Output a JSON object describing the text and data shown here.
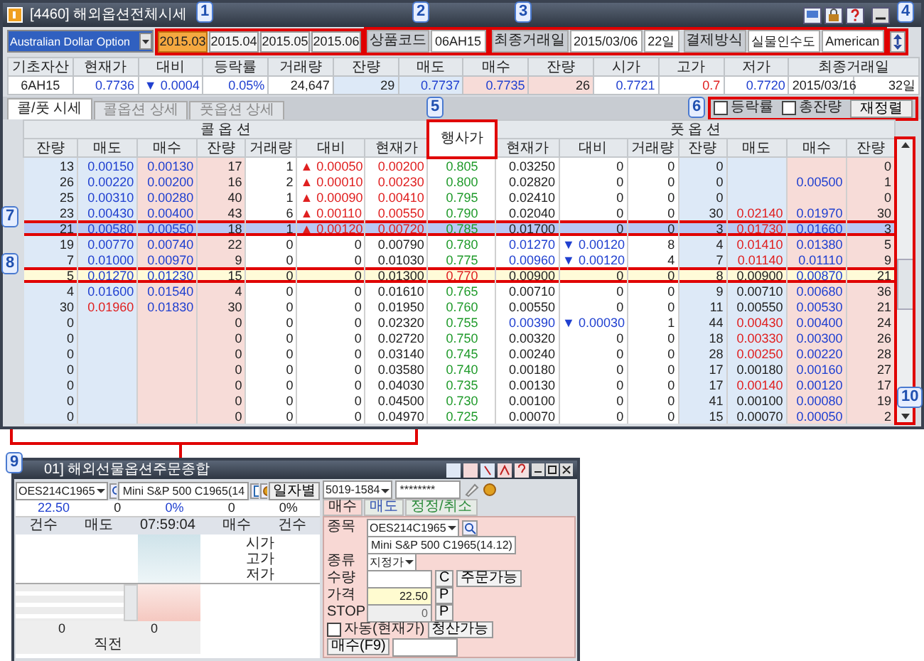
{
  "window": {
    "title": "[4460] 해외옵션전체시세"
  },
  "product_select": {
    "value": "Australian Dollar Option"
  },
  "months": [
    {
      "label": "2015.03",
      "selected": true
    },
    {
      "label": "2015.04",
      "selected": false
    },
    {
      "label": "2015.05",
      "selected": false
    },
    {
      "label": "2015.06",
      "selected": false
    }
  ],
  "product_code": {
    "label": "상품코드",
    "value": "06AH15"
  },
  "last_trade": {
    "label": "최종거래일",
    "date": "2015/03/06",
    "days": "22일"
  },
  "settlement": {
    "label": "결제방식",
    "method": "실물인수도",
    "style": "American"
  },
  "info": {
    "headers": [
      "기초자산",
      "현재가",
      "대비",
      "등락률",
      "거래량",
      "잔량",
      "매도",
      "매수",
      "잔량",
      "시가",
      "고가",
      "저가",
      "최종거래일"
    ],
    "cells": [
      {
        "text": "6AH15",
        "color": "#222222"
      },
      {
        "text": "0.7736",
        "color": "#2040d0"
      },
      {
        "text": "▼ 0.0004",
        "color": "#2040d0"
      },
      {
        "text": "0.05%",
        "color": "#2040d0"
      },
      {
        "text": "24,647",
        "color": "#222222"
      },
      {
        "text": "29",
        "color": "#222222"
      },
      {
        "text": "0.7737",
        "color": "#2040d0"
      },
      {
        "text": "0.7735",
        "color": "#2040d0"
      },
      {
        "text": "26",
        "color": "#222222"
      },
      {
        "text": "0.7721",
        "color": "#2040d0"
      },
      {
        "text": "0.7",
        "color": "#e02020"
      },
      {
        "text": "0.7720",
        "color": "#2040d0"
      },
      {
        "text": "2015/03/16",
        "color": "#222222"
      },
      {
        "text": "32일",
        "color": "#222222"
      }
    ]
  },
  "tabs": [
    {
      "label": "콜/풋 시세",
      "selected": true
    },
    {
      "label": "콜옵션 상세",
      "selected": false
    },
    {
      "label": "풋옵션 상세",
      "selected": false
    }
  ],
  "options": [
    {
      "label": "등락률",
      "checked": false
    },
    {
      "label": "총잔량",
      "checked": false
    }
  ],
  "rearrange_button": "재정렬",
  "table": {
    "call_title": "콜 옵 션",
    "put_title": "풋 옵 션",
    "strike_header": "행사가",
    "call_columns": [
      "잔량",
      "매도",
      "매수",
      "잔량",
      "거래량",
      "대비",
      "현재가"
    ],
    "put_columns": [
      "현재가",
      "대비",
      "거래량",
      "잔량",
      "매도",
      "매수",
      "잔량"
    ],
    "rows": [
      {
        "strike": "0.805",
        "call": {
          "ask_size": "13",
          "ask": {
            "text": "0.00150",
            "color": "#2040d0"
          },
          "bid": "0.00130",
          "bid_size": "17",
          "volume": "1",
          "change": {
            "text": "▲ 0.00050",
            "color": "#e02020"
          },
          "price": {
            "text": "0.00200",
            "color": "#e02020"
          }
        },
        "put": {
          "price": {
            "text": "0.03250",
            "color": "#222222"
          },
          "change": {
            "text": "0",
            "color": "#222222"
          },
          "volume": "0",
          "ask_size": "0",
          "bid_size": "0"
        },
        "selected": false,
        "at_the_money": false
      },
      {
        "strike": "0.800",
        "call": {
          "ask_size": "26",
          "ask": {
            "text": "0.00220",
            "color": "#2040d0"
          },
          "bid": "0.00200",
          "bid_size": "16",
          "volume": "2",
          "change": {
            "text": "▲ 0.00010",
            "color": "#e02020"
          },
          "price": {
            "text": "0.00230",
            "color": "#e02020"
          }
        },
        "put": {
          "price": {
            "text": "0.02820",
            "color": "#222222"
          },
          "change": {
            "text": "0",
            "color": "#222222"
          },
          "volume": "0",
          "ask_size": "0",
          "bid": "0.00500",
          "bid_size": "1"
        },
        "selected": false,
        "at_the_money": false
      },
      {
        "strike": "0.795",
        "call": {
          "ask_size": "25",
          "ask": {
            "text": "0.00310",
            "color": "#2040d0"
          },
          "bid": "0.00280",
          "bid_size": "40",
          "volume": "1",
          "change": {
            "text": "▲ 0.00090",
            "color": "#e02020"
          },
          "price": {
            "text": "0.00410",
            "color": "#e02020"
          }
        },
        "put": {
          "price": {
            "text": "0.02410",
            "color": "#222222"
          },
          "change": {
            "text": "0",
            "color": "#222222"
          },
          "volume": "0",
          "ask_size": "0",
          "bid_size": "0"
        },
        "selected": false,
        "at_the_money": false
      },
      {
        "strike": "0.790",
        "call": {
          "ask_size": "23",
          "ask": {
            "text": "0.00430",
            "color": "#2040d0"
          },
          "bid": "0.00400",
          "bid_size": "43",
          "volume": "6",
          "change": {
            "text": "▲ 0.00110",
            "color": "#e02020"
          },
          "price": {
            "text": "0.00550",
            "color": "#e02020"
          }
        },
        "put": {
          "price": {
            "text": "0.02040",
            "color": "#222222"
          },
          "change": {
            "text": "0",
            "color": "#222222"
          },
          "volume": "0",
          "ask_size": "30",
          "ask": {
            "text": "0.02140",
            "color": "#e02020"
          },
          "bid": "0.01970",
          "bid_size": "30"
        },
        "selected": false,
        "at_the_money": false
      },
      {
        "strike": "0.785",
        "call": {
          "ask_size": "21",
          "ask": {
            "text": "0.00580",
            "color": "#2040d0"
          },
          "bid": "0.00550",
          "bid_size": "18",
          "volume": "1",
          "change": {
            "text": "▲ 0.00120",
            "color": "#e02020"
          },
          "price": {
            "text": "0.00720",
            "color": "#e02020"
          }
        },
        "put": {
          "price": {
            "text": "0.01700",
            "color": "#222222"
          },
          "change": {
            "text": "0",
            "color": "#222222"
          },
          "volume": "0",
          "ask_size": "3",
          "ask": {
            "text": "0.01730",
            "color": "#e02020"
          },
          "bid": "0.01660",
          "bid_size": "3"
        },
        "selected": true,
        "at_the_money": false
      },
      {
        "strike": "0.780",
        "call": {
          "ask_size": "19",
          "ask": {
            "text": "0.00770",
            "color": "#2040d0"
          },
          "bid": "0.00740",
          "bid_size": "22",
          "volume": "0",
          "change": {
            "text": "0",
            "color": "#222222"
          },
          "price": {
            "text": "0.00790",
            "color": "#222222"
          }
        },
        "put": {
          "price": {
            "text": "0.01270",
            "color": "#2040d0"
          },
          "change": {
            "text": "▼ 0.00120",
            "color": "#2040d0"
          },
          "volume": "8",
          "ask_size": "4",
          "ask": {
            "text": "0.01410",
            "color": "#e02020"
          },
          "bid": "0.01380",
          "bid_size": "5"
        },
        "selected": false,
        "at_the_money": false
      },
      {
        "strike": "0.775",
        "call": {
          "ask_size": "7",
          "ask": {
            "text": "0.01000",
            "color": "#2040d0"
          },
          "bid": "0.00970",
          "bid_size": "9",
          "volume": "0",
          "change": {
            "text": "0",
            "color": "#222222"
          },
          "price": {
            "text": "0.01030",
            "color": "#222222"
          }
        },
        "put": {
          "price": {
            "text": "0.00960",
            "color": "#2040d0"
          },
          "change": {
            "text": "▼ 0.00120",
            "color": "#2040d0"
          },
          "volume": "4",
          "ask_size": "7",
          "ask": {
            "text": "0.01140",
            "color": "#e02020"
          },
          "bid": "0.01110",
          "bid_size": "9"
        },
        "selected": false,
        "at_the_money": false
      },
      {
        "strike": "0.770",
        "call": {
          "ask_size": "5",
          "ask": {
            "text": "0.01270",
            "color": "#2040d0"
          },
          "bid": "0.01230",
          "bid_size": "15",
          "volume": "0",
          "change": {
            "text": "0",
            "color": "#222222"
          },
          "price": {
            "text": "0.01300",
            "color": "#222222"
          }
        },
        "put": {
          "price": {
            "text": "0.00900",
            "color": "#222222"
          },
          "change": {
            "text": "0",
            "color": "#222222"
          },
          "volume": "0",
          "ask_size": "8",
          "ask": {
            "text": "0.00900",
            "color": "#222222"
          },
          "bid": "0.00870",
          "bid_size": "21"
        },
        "selected": false,
        "at_the_money": true
      },
      {
        "strike": "0.765",
        "call": {
          "ask_size": "4",
          "ask": {
            "text": "0.01600",
            "color": "#2040d0"
          },
          "bid": "0.01540",
          "bid_size": "4",
          "volume": "0",
          "change": {
            "text": "0",
            "color": "#222222"
          },
          "price": {
            "text": "0.01610",
            "color": "#222222"
          }
        },
        "put": {
          "price": {
            "text": "0.00710",
            "color": "#222222"
          },
          "change": {
            "text": "0",
            "color": "#222222"
          },
          "volume": "0",
          "ask_size": "9",
          "ask": {
            "text": "0.00710",
            "color": "#222222"
          },
          "bid": "0.00680",
          "bid_size": "36"
        },
        "selected": false,
        "at_the_money": false
      },
      {
        "strike": "0.760",
        "call": {
          "ask_size": "30",
          "ask": {
            "text": "0.01960",
            "color": "#e02020"
          },
          "bid": "0.01830",
          "bid_size": "30",
          "volume": "0",
          "change": {
            "text": "0",
            "color": "#222222"
          },
          "price": {
            "text": "0.01950",
            "color": "#222222"
          }
        },
        "put": {
          "price": {
            "text": "0.00550",
            "color": "#222222"
          },
          "change": {
            "text": "0",
            "color": "#222222"
          },
          "volume": "0",
          "ask_size": "11",
          "ask": {
            "text": "0.00550",
            "color": "#222222"
          },
          "bid": "0.00530",
          "bid_size": "21"
        },
        "selected": false,
        "at_the_money": false
      },
      {
        "strike": "0.755",
        "call": {
          "ask_size": "0",
          "bid_size": "0",
          "volume": "0",
          "change": {
            "text": "0",
            "color": "#222222"
          },
          "price": {
            "text": "0.02320",
            "color": "#222222"
          }
        },
        "put": {
          "price": {
            "text": "0.00390",
            "color": "#2040d0"
          },
          "change": {
            "text": "▼ 0.00030",
            "color": "#2040d0"
          },
          "volume": "1",
          "ask_size": "44",
          "ask": {
            "text": "0.00430",
            "color": "#e02020"
          },
          "bid": "0.00400",
          "bid_size": "24"
        },
        "selected": false,
        "at_the_money": false
      },
      {
        "strike": "0.750",
        "call": {
          "ask_size": "0",
          "bid_size": "0",
          "volume": "0",
          "change": {
            "text": "0",
            "color": "#222222"
          },
          "price": {
            "text": "0.02720",
            "color": "#222222"
          }
        },
        "put": {
          "price": {
            "text": "0.00320",
            "color": "#222222"
          },
          "change": {
            "text": "0",
            "color": "#222222"
          },
          "volume": "0",
          "ask_size": "18",
          "ask": {
            "text": "0.00330",
            "color": "#e02020"
          },
          "bid": "0.00300",
          "bid_size": "26"
        },
        "selected": false,
        "at_the_money": false
      },
      {
        "strike": "0.745",
        "call": {
          "ask_size": "0",
          "bid_size": "0",
          "volume": "0",
          "change": {
            "text": "0",
            "color": "#222222"
          },
          "price": {
            "text": "0.03140",
            "color": "#222222"
          }
        },
        "put": {
          "price": {
            "text": "0.00240",
            "color": "#222222"
          },
          "change": {
            "text": "0",
            "color": "#222222"
          },
          "volume": "0",
          "ask_size": "28",
          "ask": {
            "text": "0.00250",
            "color": "#e02020"
          },
          "bid": "0.00220",
          "bid_size": "28"
        },
        "selected": false,
        "at_the_money": false
      },
      {
        "strike": "0.740",
        "call": {
          "ask_size": "0",
          "bid_size": "0",
          "volume": "0",
          "change": {
            "text": "0",
            "color": "#222222"
          },
          "price": {
            "text": "0.03580",
            "color": "#222222"
          }
        },
        "put": {
          "price": {
            "text": "0.00180",
            "color": "#222222"
          },
          "change": {
            "text": "0",
            "color": "#222222"
          },
          "volume": "0",
          "ask_size": "17",
          "ask": {
            "text": "0.00180",
            "color": "#222222"
          },
          "bid": "0.00160",
          "bid_size": "27"
        },
        "selected": false,
        "at_the_money": false
      },
      {
        "strike": "0.735",
        "call": {
          "ask_size": "0",
          "bid_size": "0",
          "volume": "0",
          "change": {
            "text": "0",
            "color": "#222222"
          },
          "price": {
            "text": "0.04030",
            "color": "#222222"
          }
        },
        "put": {
          "price": {
            "text": "0.00130",
            "color": "#222222"
          },
          "change": {
            "text": "0",
            "color": "#222222"
          },
          "volume": "0",
          "ask_size": "17",
          "ask": {
            "text": "0.00140",
            "color": "#e02020"
          },
          "bid": "0.00120",
          "bid_size": "17"
        },
        "selected": false,
        "at_the_money": false
      },
      {
        "strike": "0.730",
        "call": {
          "ask_size": "0",
          "bid_size": "0",
          "volume": "0",
          "change": {
            "text": "0",
            "color": "#222222"
          },
          "price": {
            "text": "0.04500",
            "color": "#222222"
          }
        },
        "put": {
          "price": {
            "text": "0.00100",
            "color": "#222222"
          },
          "change": {
            "text": "0",
            "color": "#222222"
          },
          "volume": "0",
          "ask_size": "41",
          "ask": {
            "text": "0.00100",
            "color": "#222222"
          },
          "bid": "0.00080",
          "bid_size": "19"
        },
        "selected": false,
        "at_the_money": false
      },
      {
        "strike": "0.725",
        "call": {
          "ask_size": "0",
          "bid_size": "0",
          "volume": "0",
          "change": {
            "text": "0",
            "color": "#222222"
          },
          "price": {
            "text": "0.04970",
            "color": "#222222"
          }
        },
        "put": {
          "price": {
            "text": "0.00070",
            "color": "#222222"
          },
          "change": {
            "text": "0",
            "color": "#222222"
          },
          "volume": "0",
          "ask_size": "15",
          "ask": {
            "text": "0.00070",
            "color": "#222222"
          },
          "bid": "0.00050",
          "bid_size": "2"
        },
        "selected": false,
        "at_the_money": false
      }
    ]
  },
  "order_window": {
    "title": "01] 해외선물옵션주문종합",
    "symbol": "OES214C1965",
    "symbol_name": "Mini S&P 500 C1965(14",
    "daily_button": "일자별",
    "quote": [
      {
        "text": "22.50",
        "color": "#2040d0"
      },
      {
        "text": "0",
        "color": "#222222"
      },
      {
        "text": "0%",
        "color": "#2040d0"
      },
      {
        "text": "0",
        "color": "#222222"
      },
      {
        "text": "0%",
        "color": "#222222"
      }
    ],
    "book_headers": [
      "건수",
      "매도",
      "07:59:04",
      "매수",
      "건수"
    ],
    "ohl_labels": [
      "시가",
      "고가",
      "저가"
    ],
    "totals": [
      "0",
      "0"
    ],
    "prev_label": "직전",
    "account": "5019-1584",
    "password": "********",
    "order_tabs": [
      {
        "label": "매수",
        "selected": true
      },
      {
        "label": "매도",
        "selected": false
      },
      {
        "label": "정정/취소",
        "selected": false
      }
    ],
    "form": {
      "symbol_label": "종목",
      "symbol": "OES214C1965",
      "name": "Mini S&P 500 C1965(14.12)",
      "type_label": "종류",
      "type": "지정가",
      "qty_label": "수량",
      "qty_button": "C",
      "available_button": "주문가능",
      "price_label": "가격",
      "price": "22.50",
      "price_button": "P",
      "stop_label": "STOP",
      "stop": "0",
      "stop_button": "P",
      "auto": {
        "label": "자동(현재가)",
        "checked": false
      },
      "liquidate_button": "청산가능",
      "submit_button": "매수(F9)"
    }
  },
  "callouts": [
    "1",
    "2",
    "3",
    "4",
    "5",
    "6",
    "7",
    "8",
    "9",
    "10"
  ]
}
